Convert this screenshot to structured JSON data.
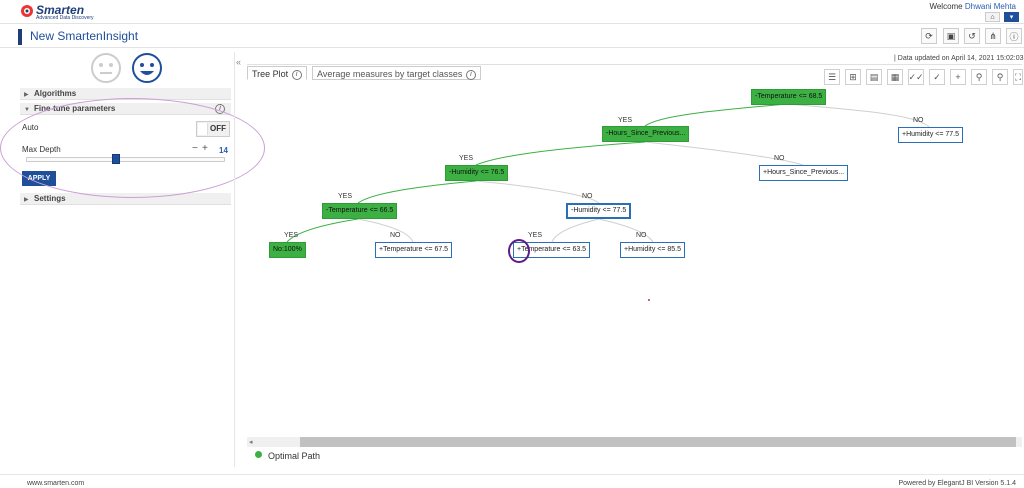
{
  "header": {
    "logo_name": "Smarten",
    "logo_tagline": "Advanced Data Discovery",
    "welcome_text": "Welcome ",
    "user_name": "Dhwani Mehta",
    "home_icon": "home-icon",
    "menu_icon": "chevron-down-icon"
  },
  "titlebar": {
    "title": "New SmartenInsight",
    "buttons": [
      "refresh-icon",
      "save-icon",
      "history-icon",
      "tree-icon",
      "info-icon"
    ]
  },
  "left_panel": {
    "sections": {
      "algorithms": "Algorithms",
      "fine_tune": "Fine-tune parameters",
      "settings": "Settings"
    },
    "auto_label": "Auto",
    "auto_toggle": "OFF",
    "max_depth_label": "Max Depth",
    "max_depth_value": "14",
    "max_depth_fraction": 0.45,
    "apply_label": "APPLY"
  },
  "main": {
    "updated_text": "|   Data updated on April 14, 2021 15:02:03",
    "tabs": [
      "Tree Plot",
      "Average measures by target classes"
    ],
    "tab_info_glyph": "i",
    "toolbar_icons": [
      "list-icon",
      "hierarchy-icon",
      "table-icon",
      "grid-icon",
      "double-check-icon",
      "check-icon",
      "plus-icon",
      "zoom-out-icon",
      "zoom-in-icon",
      "fullscreen-icon"
    ]
  },
  "tree": {
    "nodes": [
      {
        "id": "n1",
        "label": "-Temperature <= 68.5",
        "style": "green"
      },
      {
        "id": "n2",
        "label": "-Hours_Since_Previous...",
        "style": "green"
      },
      {
        "id": "n3",
        "label": "+Humidity <= 77.5",
        "style": "white"
      },
      {
        "id": "n4",
        "label": "-Humidity <= 76.5",
        "style": "green"
      },
      {
        "id": "n5",
        "label": "+Hours_Since_Previous...",
        "style": "white"
      },
      {
        "id": "n6",
        "label": "-Temperature <= 66.5",
        "style": "green"
      },
      {
        "id": "n7",
        "label": "-Humidity <= 77.5",
        "style": "white-selected"
      },
      {
        "id": "n8",
        "label": "No:100%",
        "style": "green"
      },
      {
        "id": "n9",
        "label": "+Temperature <= 67.5",
        "style": "white"
      },
      {
        "id": "n10",
        "label": "+Temperature <= 63.5",
        "style": "white"
      },
      {
        "id": "n11",
        "label": "+Humidity <= 85.5",
        "style": "white"
      }
    ],
    "edge_labels": [
      "YES",
      "NO",
      "YES",
      "NO",
      "YES",
      "NO",
      "YES",
      "NO",
      "YES",
      "NO"
    ]
  },
  "legend": {
    "optimal_path": "Optimal Path",
    "optimal_color": "#3cb043"
  },
  "footer": {
    "left": "www.smarten.com",
    "right": "Powered by ElegantJ BI Version 5.1.4"
  }
}
